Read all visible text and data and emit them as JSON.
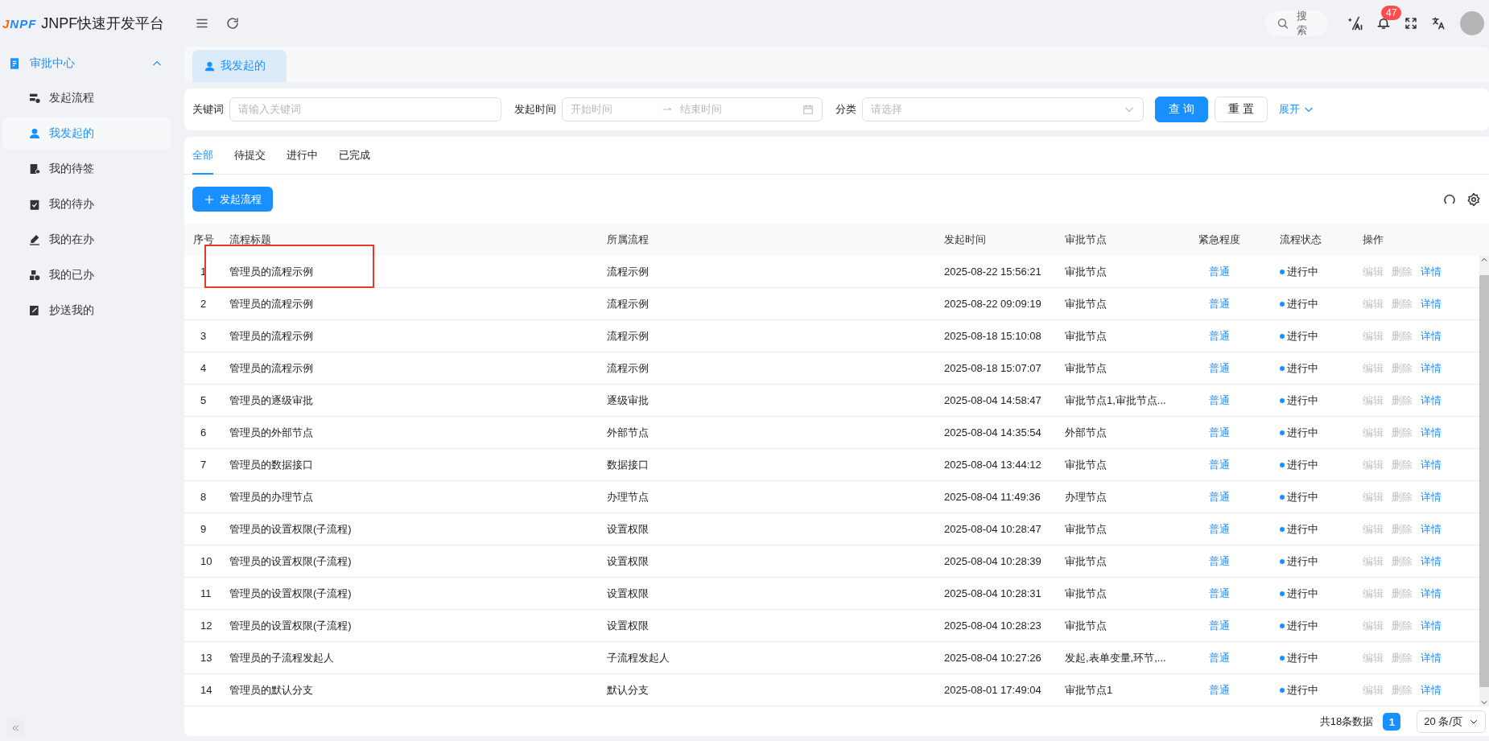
{
  "header": {
    "logo": "JNPF",
    "title": "JNPF快速开发平台",
    "search": {
      "placeholder": "搜索"
    },
    "notifications": {
      "count": "47"
    }
  },
  "sidebar": {
    "group": {
      "label": "审批中心",
      "expanded": true
    },
    "items": [
      {
        "label": "发起流程",
        "selected": false
      },
      {
        "label": "我发起的",
        "selected": true
      },
      {
        "label": "我的待签",
        "selected": false
      },
      {
        "label": "我的待办",
        "selected": false
      },
      {
        "label": "我的在办",
        "selected": false
      },
      {
        "label": "我的已办",
        "selected": false
      },
      {
        "label": "抄送我的",
        "selected": false
      }
    ]
  },
  "page_tabs": [
    {
      "label": "我发起的",
      "selected": true
    }
  ],
  "filters": {
    "keyword": {
      "label": "关键词",
      "placeholder": "请输入关键词"
    },
    "time": {
      "label": "发起时间",
      "start_placeholder": "开始时间",
      "end_placeholder": "结束时间"
    },
    "category": {
      "label": "分类",
      "placeholder": "请选择"
    },
    "buttons": [
      {
        "label": "查 询",
        "kind": "primary"
      },
      {
        "label": "重 置",
        "kind": "default"
      }
    ],
    "expand": "展开"
  },
  "status_tabs": [
    {
      "label": "全部",
      "selected": true
    },
    {
      "label": "待提交",
      "selected": false
    },
    {
      "label": "进行中",
      "selected": false
    },
    {
      "label": "已完成",
      "selected": false
    }
  ],
  "new_button": "发起流程",
  "table": {
    "columns": [
      "序号",
      "流程标题",
      "所属流程",
      "发起时间",
      "审批节点",
      "紧急程度",
      "流程状态",
      "操作"
    ],
    "rows": [
      {
        "index": "1",
        "title": "管理员的流程示例",
        "flow": "流程示例",
        "time": "2025-08-22 15:56:21",
        "node": "审批节点",
        "urgency": "普通",
        "status": "进行中",
        "actions": [
          {
            "label": "编辑",
            "disabled": true
          },
          {
            "label": "删除",
            "disabled": true
          },
          {
            "label": "详情",
            "disabled": false
          }
        ]
      },
      {
        "index": "2",
        "title": "管理员的流程示例",
        "flow": "流程示例",
        "time": "2025-08-22 09:09:19",
        "node": "审批节点",
        "urgency": "普通",
        "status": "进行中",
        "actions": [
          {
            "label": "编辑",
            "disabled": true
          },
          {
            "label": "删除",
            "disabled": true
          },
          {
            "label": "详情",
            "disabled": false
          }
        ]
      },
      {
        "index": "3",
        "title": "管理员的流程示例",
        "flow": "流程示例",
        "time": "2025-08-18 15:10:08",
        "node": "审批节点",
        "urgency": "普通",
        "status": "进行中",
        "actions": [
          {
            "label": "编辑",
            "disabled": true
          },
          {
            "label": "删除",
            "disabled": true
          },
          {
            "label": "详情",
            "disabled": false
          }
        ]
      },
      {
        "index": "4",
        "title": "管理员的流程示例",
        "flow": "流程示例",
        "time": "2025-08-18 15:07:07",
        "node": "审批节点",
        "urgency": "普通",
        "status": "进行中",
        "actions": [
          {
            "label": "编辑",
            "disabled": true
          },
          {
            "label": "删除",
            "disabled": true
          },
          {
            "label": "详情",
            "disabled": false
          }
        ]
      },
      {
        "index": "5",
        "title": "管理员的逐级审批",
        "flow": "逐级审批",
        "time": "2025-08-04 14:58:47",
        "node": "审批节点1,审批节点...",
        "urgency": "普通",
        "status": "进行中",
        "actions": [
          {
            "label": "编辑",
            "disabled": true
          },
          {
            "label": "删除",
            "disabled": true
          },
          {
            "label": "详情",
            "disabled": false
          }
        ]
      },
      {
        "index": "6",
        "title": "管理员的外部节点",
        "flow": "外部节点",
        "time": "2025-08-04 14:35:54",
        "node": "外部节点",
        "urgency": "普通",
        "status": "进行中",
        "actions": [
          {
            "label": "编辑",
            "disabled": true
          },
          {
            "label": "删除",
            "disabled": true
          },
          {
            "label": "详情",
            "disabled": false
          }
        ]
      },
      {
        "index": "7",
        "title": "管理员的数据接口",
        "flow": "数据接口",
        "time": "2025-08-04 13:44:12",
        "node": "审批节点",
        "urgency": "普通",
        "status": "进行中",
        "actions": [
          {
            "label": "编辑",
            "disabled": true
          },
          {
            "label": "删除",
            "disabled": true
          },
          {
            "label": "详情",
            "disabled": false
          }
        ]
      },
      {
        "index": "8",
        "title": "管理员的办理节点",
        "flow": "办理节点",
        "time": "2025-08-04 11:49:36",
        "node": "办理节点",
        "urgency": "普通",
        "status": "进行中",
        "actions": [
          {
            "label": "编辑",
            "disabled": true
          },
          {
            "label": "删除",
            "disabled": true
          },
          {
            "label": "详情",
            "disabled": false
          }
        ]
      },
      {
        "index": "9",
        "title": "管理员的设置权限(子流程)",
        "flow": "设置权限",
        "time": "2025-08-04 10:28:47",
        "node": "审批节点",
        "urgency": "普通",
        "status": "进行中",
        "actions": [
          {
            "label": "编辑",
            "disabled": true
          },
          {
            "label": "删除",
            "disabled": true
          },
          {
            "label": "详情",
            "disabled": false
          }
        ]
      },
      {
        "index": "10",
        "title": "管理员的设置权限(子流程)",
        "flow": "设置权限",
        "time": "2025-08-04 10:28:39",
        "node": "审批节点",
        "urgency": "普通",
        "status": "进行中",
        "actions": [
          {
            "label": "编辑",
            "disabled": true
          },
          {
            "label": "删除",
            "disabled": true
          },
          {
            "label": "详情",
            "disabled": false
          }
        ]
      },
      {
        "index": "11",
        "title": "管理员的设置权限(子流程)",
        "flow": "设置权限",
        "time": "2025-08-04 10:28:31",
        "node": "审批节点",
        "urgency": "普通",
        "status": "进行中",
        "actions": [
          {
            "label": "编辑",
            "disabled": true
          },
          {
            "label": "删除",
            "disabled": true
          },
          {
            "label": "详情",
            "disabled": false
          }
        ]
      },
      {
        "index": "12",
        "title": "管理员的设置权限(子流程)",
        "flow": "设置权限",
        "time": "2025-08-04 10:28:23",
        "node": "审批节点",
        "urgency": "普通",
        "status": "进行中",
        "actions": [
          {
            "label": "编辑",
            "disabled": true
          },
          {
            "label": "删除",
            "disabled": true
          },
          {
            "label": "详情",
            "disabled": false
          }
        ]
      },
      {
        "index": "13",
        "title": "管理员的子流程发起人",
        "flow": "子流程发起人",
        "time": "2025-08-04 10:27:26",
        "node": "发起,表单变量,环节,...",
        "urgency": "普通",
        "status": "进行中",
        "actions": [
          {
            "label": "编辑",
            "disabled": true
          },
          {
            "label": "删除",
            "disabled": true
          },
          {
            "label": "详情",
            "disabled": false
          }
        ]
      },
      {
        "index": "14",
        "title": "管理员的默认分支",
        "flow": "默认分支",
        "time": "2025-08-01 17:49:04",
        "node": "审批节点1",
        "urgency": "普通",
        "status": "进行中",
        "actions": [
          {
            "label": "编辑",
            "disabled": true
          },
          {
            "label": "删除",
            "disabled": true
          },
          {
            "label": "详情",
            "disabled": false
          }
        ]
      }
    ]
  },
  "pagination": {
    "total": "共18条数据",
    "pages": [
      {
        "label": "1",
        "selected": true
      }
    ],
    "page_size": "20 条/页"
  }
}
